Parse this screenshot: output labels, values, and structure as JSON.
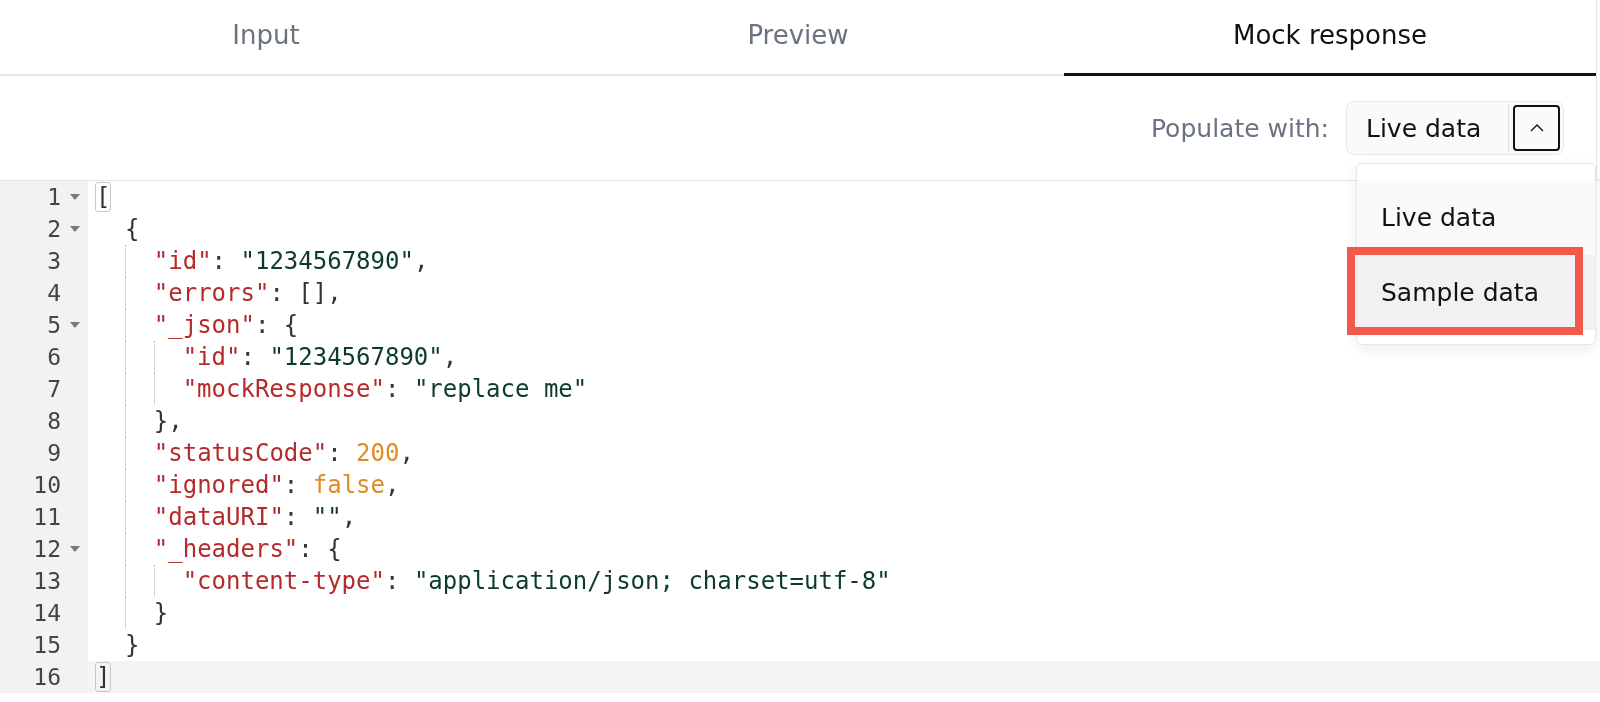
{
  "tabs": [
    {
      "label": "Input",
      "selected": false
    },
    {
      "label": "Preview",
      "selected": false
    },
    {
      "label": "Mock response",
      "selected": true
    }
  ],
  "populate": {
    "label": "Populate with:",
    "select": {
      "value": "Live data",
      "expanded": true,
      "focused": true
    },
    "menu": [
      {
        "label": "Live data",
        "selected": true,
        "highlighted": false,
        "outlined": false
      },
      {
        "label": "Sample data",
        "selected": false,
        "highlighted": true,
        "outlined": true
      }
    ]
  },
  "editor": {
    "lines": [
      {
        "number": "1",
        "foldable": true,
        "active": false,
        "matched": true,
        "tokens": [
          {
            "kind": "punct",
            "text": "["
          }
        ],
        "children": [
          {
            "number": "2",
            "foldable": true,
            "active": false,
            "matched": false,
            "tokens": [
              {
                "kind": "punct",
                "text": "{"
              }
            ],
            "children": [
              {
                "number": "3",
                "foldable": false,
                "active": false,
                "matched": false,
                "tokens": [
                  {
                    "kind": "key",
                    "text": "\"id\""
                  },
                  {
                    "kind": "punct",
                    "text": ": "
                  },
                  {
                    "kind": "string",
                    "text": "\"1234567890\""
                  },
                  {
                    "kind": "punct",
                    "text": ","
                  }
                ]
              },
              {
                "number": "4",
                "foldable": false,
                "active": false,
                "matched": false,
                "tokens": [
                  {
                    "kind": "key",
                    "text": "\"errors\""
                  },
                  {
                    "kind": "punct",
                    "text": ": [],"
                  }
                ]
              },
              {
                "number": "5",
                "foldable": true,
                "active": false,
                "matched": false,
                "tokens": [
                  {
                    "kind": "key",
                    "text": "\"_json\""
                  },
                  {
                    "kind": "punct",
                    "text": ": {"
                  }
                ],
                "children": [
                  {
                    "number": "6",
                    "foldable": false,
                    "active": false,
                    "matched": false,
                    "tokens": [
                      {
                        "kind": "key",
                        "text": "\"id\""
                      },
                      {
                        "kind": "punct",
                        "text": ": "
                      },
                      {
                        "kind": "string",
                        "text": "\"1234567890\""
                      },
                      {
                        "kind": "punct",
                        "text": ","
                      }
                    ]
                  },
                  {
                    "number": "7",
                    "foldable": false,
                    "active": false,
                    "matched": false,
                    "tokens": [
                      {
                        "kind": "key",
                        "text": "\"mockResponse\""
                      },
                      {
                        "kind": "punct",
                        "text": ": "
                      },
                      {
                        "kind": "string",
                        "text": "\"replace me\""
                      }
                    ]
                  }
                ]
              },
              {
                "number": "8",
                "foldable": false,
                "active": false,
                "matched": false,
                "tokens": [
                  {
                    "kind": "punct",
                    "text": "},"
                  }
                ]
              },
              {
                "number": "9",
                "foldable": false,
                "active": false,
                "matched": false,
                "tokens": [
                  {
                    "kind": "key",
                    "text": "\"statusCode\""
                  },
                  {
                    "kind": "punct",
                    "text": ": "
                  },
                  {
                    "kind": "literal",
                    "text": "200"
                  },
                  {
                    "kind": "punct",
                    "text": ","
                  }
                ]
              },
              {
                "number": "10",
                "foldable": false,
                "active": false,
                "matched": false,
                "tokens": [
                  {
                    "kind": "key",
                    "text": "\"ignored\""
                  },
                  {
                    "kind": "punct",
                    "text": ": "
                  },
                  {
                    "kind": "literal",
                    "text": "false"
                  },
                  {
                    "kind": "punct",
                    "text": ","
                  }
                ]
              },
              {
                "number": "11",
                "foldable": false,
                "active": false,
                "matched": false,
                "tokens": [
                  {
                    "kind": "key",
                    "text": "\"dataURI\""
                  },
                  {
                    "kind": "punct",
                    "text": ": "
                  },
                  {
                    "kind": "string",
                    "text": "\"\""
                  },
                  {
                    "kind": "punct",
                    "text": ","
                  }
                ]
              },
              {
                "number": "12",
                "foldable": true,
                "active": false,
                "matched": false,
                "tokens": [
                  {
                    "kind": "key",
                    "text": "\"_headers\""
                  },
                  {
                    "kind": "punct",
                    "text": ": {"
                  }
                ],
                "children": [
                  {
                    "number": "13",
                    "foldable": false,
                    "active": false,
                    "matched": false,
                    "tokens": [
                      {
                        "kind": "key",
                        "text": "\"content-type\""
                      },
                      {
                        "kind": "punct",
                        "text": ": "
                      },
                      {
                        "kind": "string",
                        "text": "\"application/json; charset=utf-8\""
                      }
                    ]
                  }
                ]
              },
              {
                "number": "14",
                "foldable": false,
                "active": false,
                "matched": false,
                "tokens": [
                  {
                    "kind": "punct",
                    "text": "}"
                  }
                ]
              }
            ]
          },
          {
            "number": "15",
            "foldable": false,
            "active": false,
            "matched": false,
            "tokens": [
              {
                "kind": "punct",
                "text": "}"
              }
            ]
          }
        ]
      },
      {
        "number": "16",
        "foldable": false,
        "active": true,
        "matched": true,
        "tokens": [
          {
            "kind": "punct",
            "text": "]"
          }
        ]
      }
    ]
  }
}
